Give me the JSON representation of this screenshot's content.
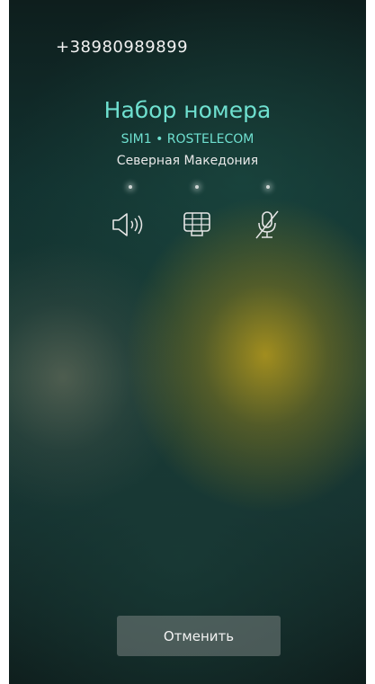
{
  "call": {
    "number": "+38980989899",
    "status": "Набор номера",
    "sim_label": "SIM1 • ROSTELECOM",
    "country": "Северная Македония"
  },
  "controls": [
    {
      "icon": "speaker-icon",
      "state": "off"
    },
    {
      "icon": "dialpad-icon",
      "state": "off"
    },
    {
      "icon": "mute-icon",
      "state": "off"
    }
  ],
  "actions": {
    "cancel_label": "Отменить"
  },
  "colors": {
    "accent": "#6fe0d0",
    "text": "#f2f2f2"
  }
}
